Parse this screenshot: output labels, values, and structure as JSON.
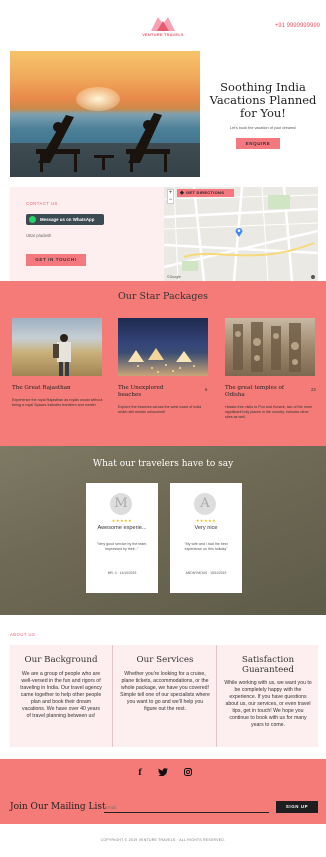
{
  "header": {
    "brand": "VENTURE TRAVELS",
    "phone": "+91 9999999999"
  },
  "hero": {
    "title": "Soothing India Vacations Planned for You!",
    "subtitle": "Let's book the vacation of your dreams!",
    "cta": "ENQUIRE"
  },
  "contact": {
    "label": "CONTACT US",
    "whatsapp": "Message us on WhatsApp",
    "location": "Uttar pradesh",
    "cta": "GET IN TOUCH!",
    "map_directions": "GET DIRECTIONS",
    "map_zoom_in": "+",
    "map_zoom_out": "−",
    "map_credit": "©Google"
  },
  "packages": {
    "title": "Our Star Packages",
    "items": [
      {
        "name": "The Great Rajasthan",
        "num": "",
        "desc": "Experience the royal Rajasthan as royals would without being a royal Spaces Includes transfers and meals!"
      },
      {
        "name": "The Unexplored beaches",
        "num": "5",
        "desc": "Explore the beaches across the west coast of India which still remain untouched!"
      },
      {
        "name": "The great temples of Odisha",
        "num": "23",
        "desc": "Hassle-free visits to Puri and Konark, two of the most significant holy places in the country, includes other sites as well."
      }
    ]
  },
  "testimonials": {
    "title": "What our travelers have to say",
    "items": [
      {
        "initial": "M",
        "stars": "★★★★★",
        "title": "Awesome experie...",
        "quote": "\"Very good service by the team. Impressed by their...\"",
        "by": "MR. X · 14/10/2019"
      },
      {
        "initial": "A",
        "stars": "★★★★★",
        "title": "Very nice",
        "quote": "\"My wife and I had the best experience on this holiday\"",
        "by": "ANONYMOUS · 15/11/2019"
      }
    ]
  },
  "about": {
    "label": "ABOUT US",
    "cols": [
      {
        "title": "Our Background",
        "body": "We are a group of people who are well-versed in the fun and rigors of traveling in India. Our travel agency came together to help other people plan and book their dream vacations. We have over 40 years of travel planning between us!"
      },
      {
        "title": "Our Services",
        "body": "Whether you're looking for a cruise, plane tickets, accommodations, or the whole package, we have you covered! Simple tell one of our specialists where you want to go and we'll help you figure out the rest."
      },
      {
        "title": "Satisfaction Guaranteed",
        "body": "While working with us, we want you to be completely happy with the experience. If you have questions about us, our services, or even travel tips, get in touch! We hope you continue to book with us for many years to come."
      }
    ]
  },
  "footer": {
    "social": [
      "f",
      "t",
      "i"
    ],
    "mailing_title": "Join Our Mailing List",
    "email_placeholder": "Email",
    "signup": "SIGN UP",
    "copyright": "COPYRIGHT © 2019 VENTURE TRAVELS · ALL RIGHTS RESERVED."
  },
  "colors": {
    "accent": "#f47b78",
    "brand": "#e85c6f",
    "light": "#fdeef0"
  }
}
